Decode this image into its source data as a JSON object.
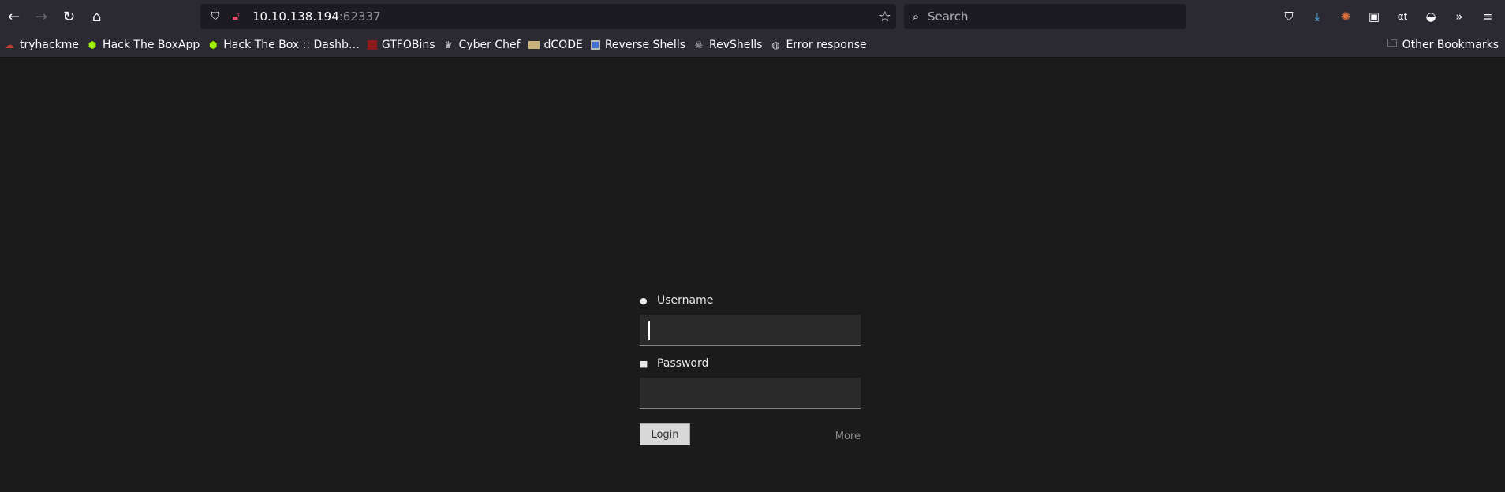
{
  "browser": {
    "url_host": "10.10.138.194",
    "url_port": ":62337",
    "search_placeholder": "Search"
  },
  "bookmarks": [
    {
      "label": "tryhackme",
      "icon": "tryhackme-icon",
      "color": "#c0392b"
    },
    {
      "label": "Hack The BoxApp",
      "icon": "hackthebox-icon",
      "color": "#9fef00"
    },
    {
      "label": "Hack The Box :: Dashb…",
      "icon": "hackthebox-icon",
      "color": "#9fef00"
    },
    {
      "label": "GTFOBins",
      "icon": "gtfobins-icon",
      "color": "#8b1a1a"
    },
    {
      "label": "Cyber Chef",
      "icon": "cyberchef-icon",
      "color": "#dddddd"
    },
    {
      "label": "dCODE",
      "icon": "dcode-icon",
      "color": "#c9b27a"
    },
    {
      "label": "Reverse Shells",
      "icon": "reverse-shells-icon",
      "color": "#3d6fd6"
    },
    {
      "label": "RevShells",
      "icon": "skull-icon",
      "color": "#dddddd"
    },
    {
      "label": "Error response",
      "icon": "globe-icon",
      "color": "#dddddd"
    }
  ],
  "other_bookmarks": "Other Bookmarks",
  "login": {
    "username_label": "Username",
    "password_label": "Password",
    "login_button": "Login",
    "more_link": "More"
  }
}
